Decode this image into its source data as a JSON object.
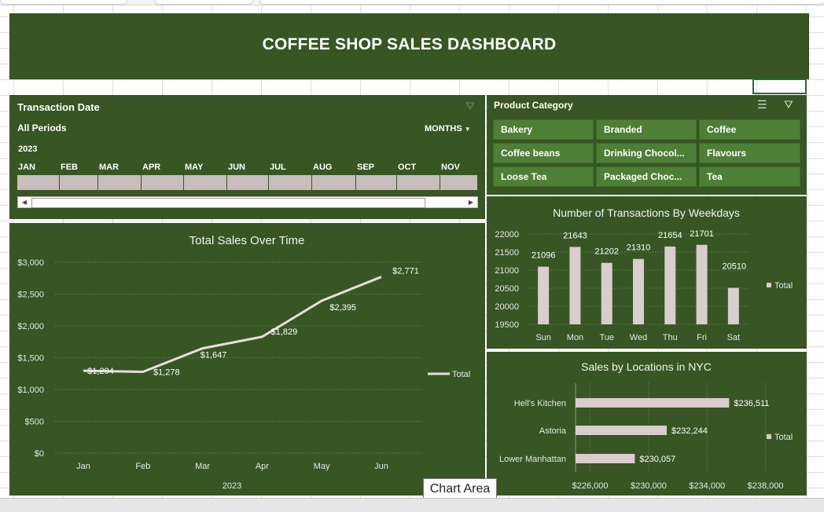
{
  "dashboard": {
    "title": "COFFEE SHOP SALES DASHBOARD"
  },
  "colors": {
    "panel": "#375623",
    "bar": "#d9cdcd",
    "button": "#4e7f36",
    "line": "#e8dede"
  },
  "timeline": {
    "title": "Transaction Date",
    "filter_icon": "clear-filter-icon",
    "periods_label": "All Periods",
    "level_label": "MONTHS",
    "year": "2023",
    "months": [
      "JAN",
      "FEB",
      "MAR",
      "APR",
      "MAY",
      "JUN",
      "JUL",
      "AUG",
      "SEP",
      "OCT",
      "NOV"
    ]
  },
  "slicer": {
    "title": "Product Category",
    "items": [
      "Bakery",
      "Branded",
      "Coffee",
      "Coffee beans",
      "Drinking Chocol...",
      "Flavours",
      "Loose Tea",
      "Packaged Choc...",
      "Tea"
    ]
  },
  "tooltip": {
    "text": "Chart Area"
  },
  "chart_data": [
    {
      "type": "line",
      "title": "Total Sales Over Time",
      "xlabel": "2023",
      "categories": [
        "Jan",
        "Feb",
        "Mar",
        "Apr",
        "May",
        "Jun"
      ],
      "series": [
        {
          "name": "Total",
          "values": [
            1294,
            1278,
            1647,
            1829,
            2395,
            2771
          ]
        }
      ],
      "data_labels": [
        "$1,294",
        "$1,278",
        "$1,647",
        "$1,829",
        "$2,395",
        "$2,771"
      ],
      "yticks": [
        "$0",
        "$500",
        "$1,000",
        "$1,500",
        "$2,000",
        "$2,500",
        "$3,000"
      ],
      "ylim": [
        0,
        3000
      ],
      "legend": "right",
      "grid": true
    },
    {
      "type": "bar",
      "title": "Number of Transactions By Weekdays",
      "categories": [
        "Sun",
        "Mon",
        "Tue",
        "Wed",
        "Thu",
        "Fri",
        "Sat"
      ],
      "series": [
        {
          "name": "Total",
          "values": [
            21096,
            21643,
            21202,
            21310,
            21654,
            21701,
            20510
          ]
        }
      ],
      "data_labels": [
        "21096",
        "21643",
        "21202",
        "21310",
        "21654",
        "21701",
        "20510"
      ],
      "yticks": [
        "19500",
        "20000",
        "20500",
        "21000",
        "21500",
        "22000"
      ],
      "ylim": [
        19500,
        22000
      ],
      "legend": "right",
      "grid": true
    },
    {
      "type": "bar",
      "orientation": "horizontal",
      "title": "Sales by Locations in NYC",
      "categories": [
        "Hell's Kitchen",
        "Astoria",
        "Lower Manhattan"
      ],
      "series": [
        {
          "name": "Total",
          "values": [
            236511,
            232244,
            230057
          ]
        }
      ],
      "data_labels": [
        "$236,511",
        "$232,244",
        "$230,057"
      ],
      "xticks": [
        "$226,000",
        "$230,000",
        "$234,000",
        "$238,000"
      ],
      "xlim": [
        226000,
        238000
      ],
      "legend": "right",
      "grid": true
    }
  ]
}
